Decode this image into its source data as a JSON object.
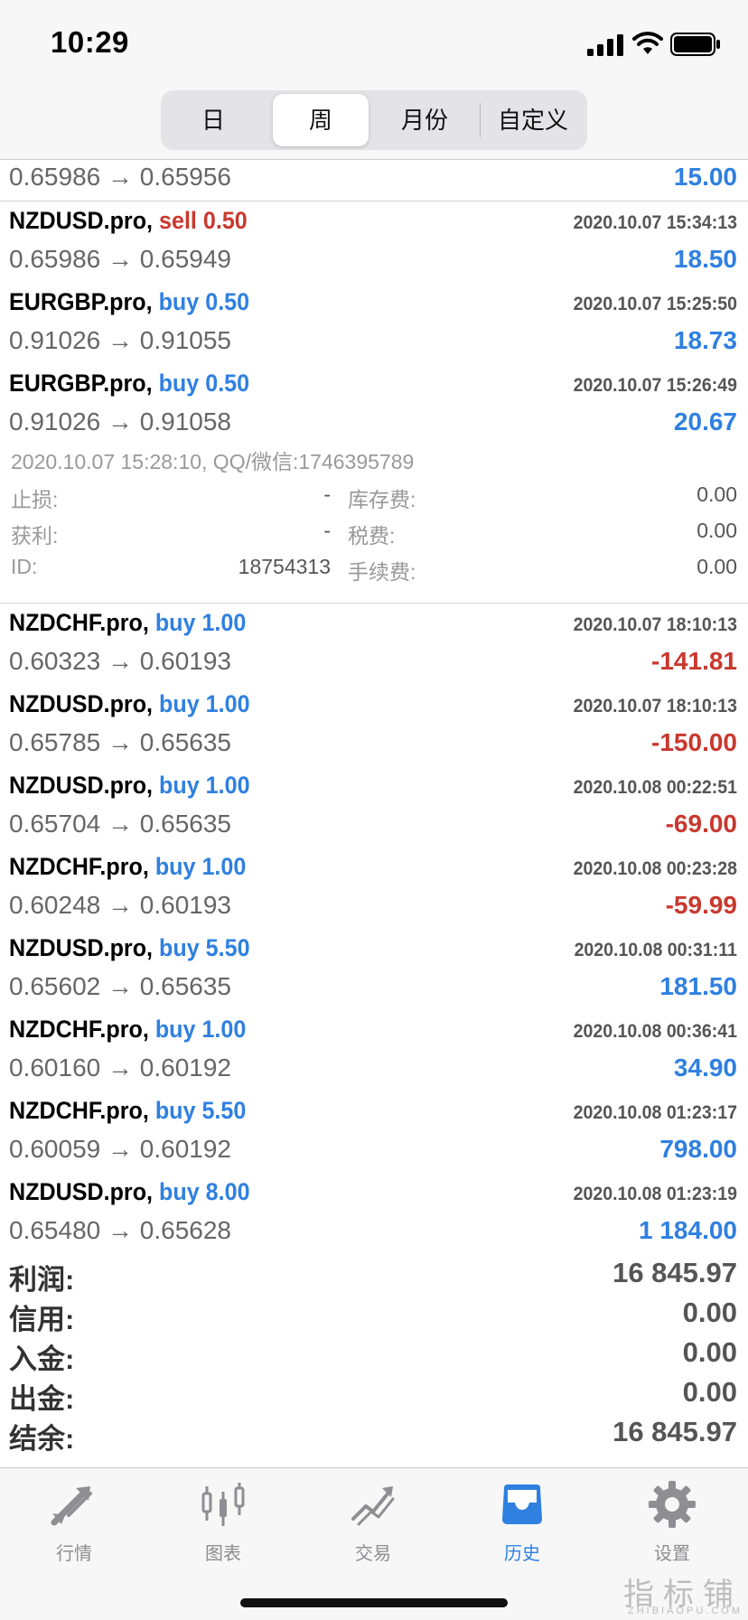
{
  "status_bar": {
    "time": "10:29"
  },
  "segments": {
    "items": [
      "日",
      "周",
      "月份",
      "自定义"
    ],
    "active": "周"
  },
  "partial_row": {
    "prices": "0.65986 → 0.65956",
    "profit": "15.00"
  },
  "trades": [
    {
      "symbol": "NZDUSD.pro,",
      "side": "sell",
      "volume": "0.50",
      "datetime": "2020.10.07 15:34:13",
      "prices": "0.65986 → 0.65949",
      "profit": "18.50",
      "sign": "pos"
    },
    {
      "symbol": "EURGBP.pro,",
      "side": "buy",
      "volume": "0.50",
      "datetime": "2020.10.07 15:25:50",
      "prices": "0.91026 → 0.91055",
      "profit": "18.73",
      "sign": "pos"
    },
    {
      "symbol": "EURGBP.pro,",
      "side": "buy",
      "volume": "0.50",
      "datetime": "2020.10.07 15:26:49",
      "prices": "0.91026 → 0.91058",
      "profit": "20.67",
      "sign": "pos"
    },
    {
      "symbol": "NZDCHF.pro,",
      "side": "buy",
      "volume": "1.00",
      "datetime": "2020.10.07 18:10:13",
      "prices": "0.60323 → 0.60193",
      "profit": "-141.81",
      "sign": "neg"
    },
    {
      "symbol": "NZDUSD.pro,",
      "side": "buy",
      "volume": "1.00",
      "datetime": "2020.10.07 18:10:13",
      "prices": "0.65785 → 0.65635",
      "profit": "-150.00",
      "sign": "neg"
    },
    {
      "symbol": "NZDUSD.pro,",
      "side": "buy",
      "volume": "1.00",
      "datetime": "2020.10.08 00:22:51",
      "prices": "0.65704 → 0.65635",
      "profit": "-69.00",
      "sign": "neg"
    },
    {
      "symbol": "NZDCHF.pro,",
      "side": "buy",
      "volume": "1.00",
      "datetime": "2020.10.08 00:23:28",
      "prices": "0.60248 → 0.60193",
      "profit": "-59.99",
      "sign": "neg"
    },
    {
      "symbol": "NZDUSD.pro,",
      "side": "buy",
      "volume": "5.50",
      "datetime": "2020.10.08 00:31:11",
      "prices": "0.65602 → 0.65635",
      "profit": "181.50",
      "sign": "pos"
    },
    {
      "symbol": "NZDCHF.pro,",
      "side": "buy",
      "volume": "1.00",
      "datetime": "2020.10.08 00:36:41",
      "prices": "0.60160 → 0.60192",
      "profit": "34.90",
      "sign": "pos"
    },
    {
      "symbol": "NZDCHF.pro,",
      "side": "buy",
      "volume": "5.50",
      "datetime": "2020.10.08 01:23:17",
      "prices": "0.60059 → 0.60192",
      "profit": "798.00",
      "sign": "pos"
    },
    {
      "symbol": "NZDUSD.pro,",
      "side": "buy",
      "volume": "8.00",
      "datetime": "2020.10.08 01:23:19",
      "prices": "0.65480 → 0.65628",
      "profit": "1 184.00",
      "sign": "pos"
    }
  ],
  "detail": {
    "comment": "2020.10.07 15:28:10, QQ/微信:1746395789",
    "stop_loss_label": "止损:",
    "stop_loss": "-",
    "swap_label": "库存费:",
    "swap": "0.00",
    "take_profit_label": "获利:",
    "take_profit": "-",
    "tax_label": "税费:",
    "tax": "0.00",
    "id_label": "ID:",
    "id": "18754313",
    "fee_label": "手续费:",
    "fee": "0.00"
  },
  "summary": {
    "profit_label": "利润:",
    "profit": "16 845.97",
    "credit_label": "信用:",
    "credit": "0.00",
    "deposit_label": "入金:",
    "deposit": "0.00",
    "withdrawal_label": "出金:",
    "withdrawal": "0.00",
    "balance_label": "结余:",
    "balance": "16 845.97"
  },
  "tabs": [
    {
      "label": "行情",
      "icon": "quotes-arrows-icon"
    },
    {
      "label": "图表",
      "icon": "candlestick-chart-icon"
    },
    {
      "label": "交易",
      "icon": "trade-chart-icon"
    },
    {
      "label": "历史",
      "icon": "history-tray-icon",
      "active": true
    },
    {
      "label": "设置",
      "icon": "gear-icon"
    }
  ],
  "watermark": {
    "cn": "指标铺",
    "en": "ZHIBIAOPU.COM"
  },
  "colors": {
    "buy": "#2f80e0",
    "sell": "#c9382e",
    "active_tab": "#2f80e0",
    "inactive_tab": "#8e8e93"
  }
}
